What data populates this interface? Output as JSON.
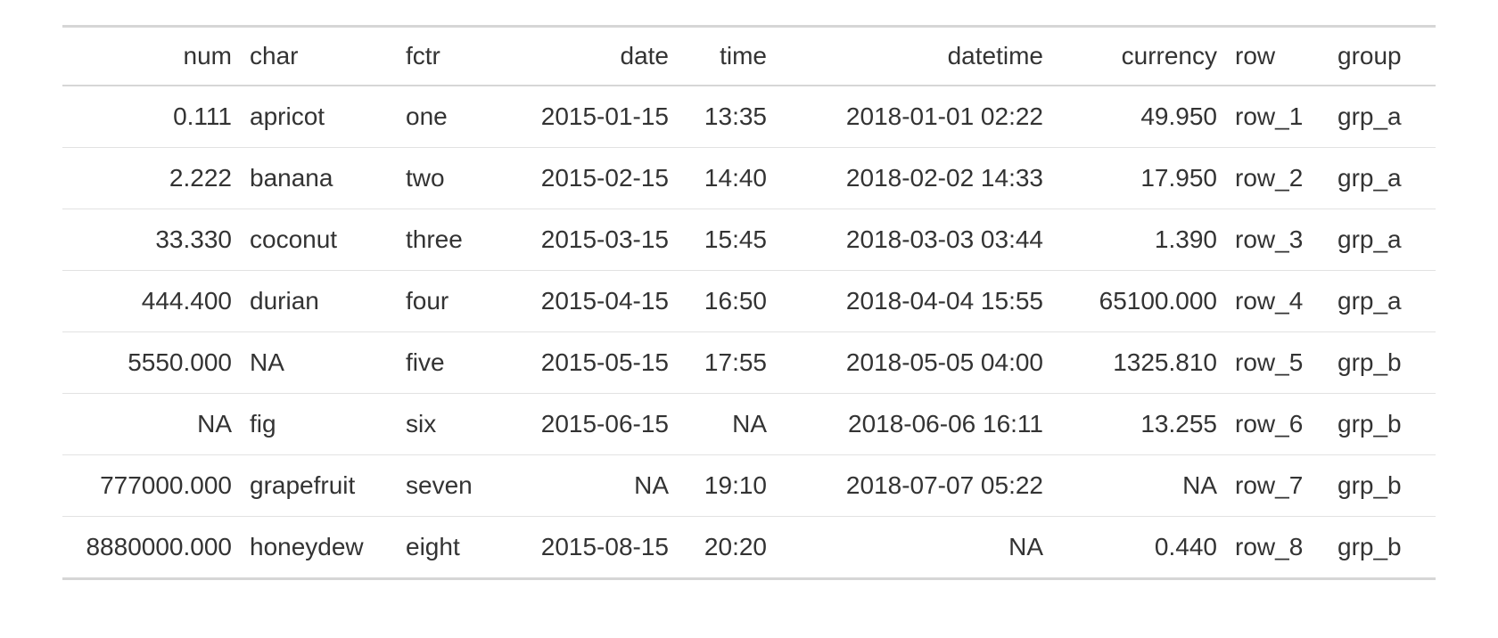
{
  "table": {
    "columns": [
      {
        "key": "num",
        "label": "num",
        "align": "r"
      },
      {
        "key": "char",
        "label": "char",
        "align": "l"
      },
      {
        "key": "fctr",
        "label": "fctr",
        "align": "l"
      },
      {
        "key": "date",
        "label": "date",
        "align": "r"
      },
      {
        "key": "time",
        "label": "time",
        "align": "r"
      },
      {
        "key": "datetime",
        "label": "datetime",
        "align": "r"
      },
      {
        "key": "currency",
        "label": "currency",
        "align": "r"
      },
      {
        "key": "row",
        "label": "row",
        "align": "l"
      },
      {
        "key": "group",
        "label": "group",
        "align": "l"
      }
    ],
    "rows": [
      {
        "num": "0.111",
        "char": "apricot",
        "fctr": "one",
        "date": "2015-01-15",
        "time": "13:35",
        "datetime": "2018-01-01 02:22",
        "currency": "49.950",
        "row": "row_1",
        "group": "grp_a"
      },
      {
        "num": "2.222",
        "char": "banana",
        "fctr": "two",
        "date": "2015-02-15",
        "time": "14:40",
        "datetime": "2018-02-02 14:33",
        "currency": "17.950",
        "row": "row_2",
        "group": "grp_a"
      },
      {
        "num": "33.330",
        "char": "coconut",
        "fctr": "three",
        "date": "2015-03-15",
        "time": "15:45",
        "datetime": "2018-03-03 03:44",
        "currency": "1.390",
        "row": "row_3",
        "group": "grp_a"
      },
      {
        "num": "444.400",
        "char": "durian",
        "fctr": "four",
        "date": "2015-04-15",
        "time": "16:50",
        "datetime": "2018-04-04 15:55",
        "currency": "65100.000",
        "row": "row_4",
        "group": "grp_a"
      },
      {
        "num": "5550.000",
        "char": "NA",
        "fctr": "five",
        "date": "2015-05-15",
        "time": "17:55",
        "datetime": "2018-05-05 04:00",
        "currency": "1325.810",
        "row": "row_5",
        "group": "grp_b"
      },
      {
        "num": "NA",
        "char": "fig",
        "fctr": "six",
        "date": "2015-06-15",
        "time": "NA",
        "datetime": "2018-06-06 16:11",
        "currency": "13.255",
        "row": "row_6",
        "group": "grp_b"
      },
      {
        "num": "777000.000",
        "char": "grapefruit",
        "fctr": "seven",
        "date": "NA",
        "time": "19:10",
        "datetime": "2018-07-07 05:22",
        "currency": "NA",
        "row": "row_7",
        "group": "grp_b"
      },
      {
        "num": "8880000.000",
        "char": "honeydew",
        "fctr": "eight",
        "date": "2015-08-15",
        "time": "20:20",
        "datetime": "NA",
        "currency": "0.440",
        "row": "row_8",
        "group": "grp_b"
      }
    ]
  }
}
